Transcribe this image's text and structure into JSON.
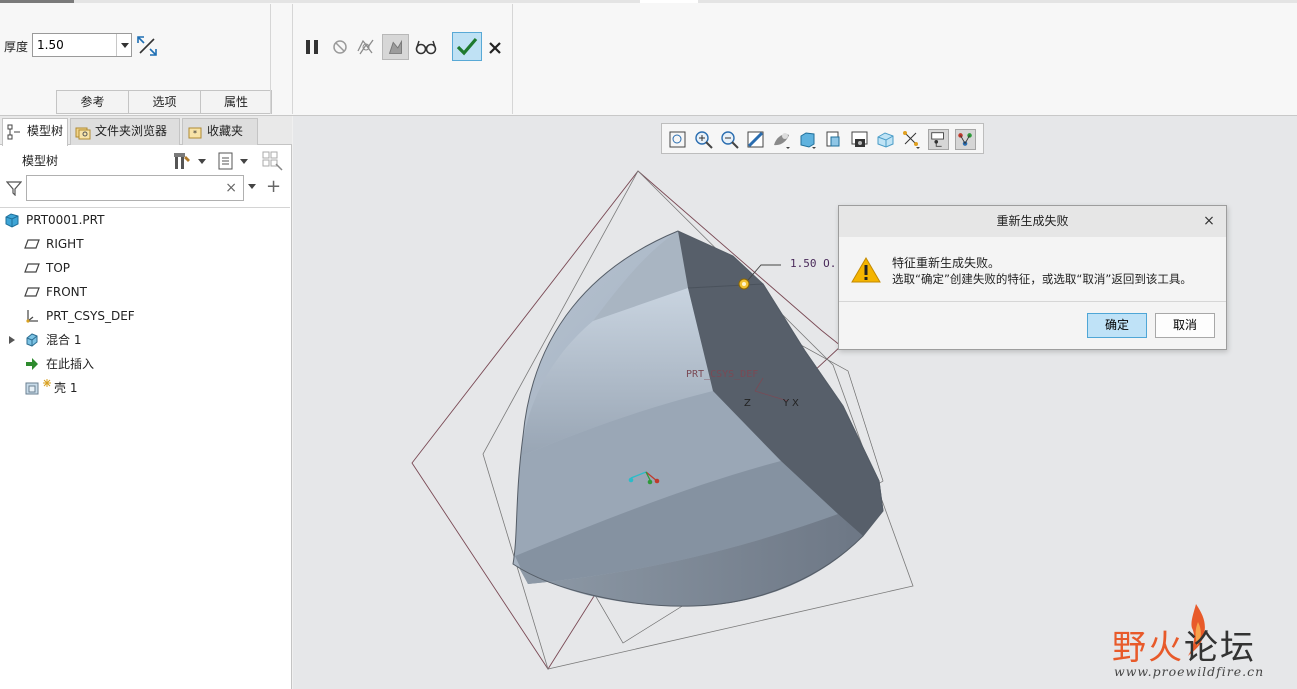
{
  "ribbon": {
    "thickness_label": "厚度",
    "thickness_value": "1.50",
    "tabs": [
      "参考",
      "选项",
      "属性"
    ],
    "icons": {
      "flip": "flip-direction-icon",
      "pause": "pause-icon",
      "stop": "stop-icon",
      "verify": "verify-mode-icon",
      "preview": "feature-preview-icon",
      "glasses": "glasses-preview-icon",
      "ok": "checkmark-icon",
      "cancel": "close-icon"
    },
    "ok_color": "#bfe1f4"
  },
  "left_panel": {
    "tabs": [
      {
        "label": "模型树",
        "icon": "model-tree-icon"
      },
      {
        "label": "文件夹浏览器",
        "icon": "folder-browser-icon"
      },
      {
        "label": "收藏夹",
        "icon": "favorites-icon"
      }
    ],
    "header": "模型树",
    "search_placeholder": "",
    "tree": [
      {
        "label": "PRT0001.PRT",
        "icon": "part-icon"
      },
      {
        "label": "RIGHT",
        "icon": "datum-plane-icon"
      },
      {
        "label": "TOP",
        "icon": "datum-plane-icon"
      },
      {
        "label": "FRONT",
        "icon": "datum-plane-icon"
      },
      {
        "label": "PRT_CSYS_DEF",
        "icon": "csys-icon"
      },
      {
        "label": "混合 1",
        "icon": "blend-icon",
        "expandable": true
      },
      {
        "label": "在此插入",
        "icon": "insert-here-arrow-icon"
      },
      {
        "label": "壳 1",
        "icon": "shell-icon"
      }
    ]
  },
  "graphics": {
    "toolbar_icons": [
      "refit-icon",
      "zoom-in-icon",
      "zoom-out-icon",
      "repaint-icon",
      "display-style-icon",
      "saved-orientations-icon",
      "view-manager-icon",
      "perspective-icon",
      "appearance-icon",
      "datum-display-icon",
      "annotation-display-icon",
      "spin-center-icon"
    ],
    "dimension_label": "1.50 O.",
    "csys_label": "PRT_CSYS_DEF",
    "axis_labels": [
      "Z",
      "Y",
      "X"
    ]
  },
  "dialog": {
    "title": "重新生成失败",
    "message_line1": "特征重新生成失败。",
    "message_line2": "选取“确定”创建失败的特征，或选取“取消”返回到该工具。",
    "ok_label": "确定",
    "cancel_label": "取消",
    "icon": "warning-icon"
  },
  "watermark": {
    "title_part1": "野火",
    "title_part2": "论坛",
    "url": "www.proewildfire.cn"
  }
}
